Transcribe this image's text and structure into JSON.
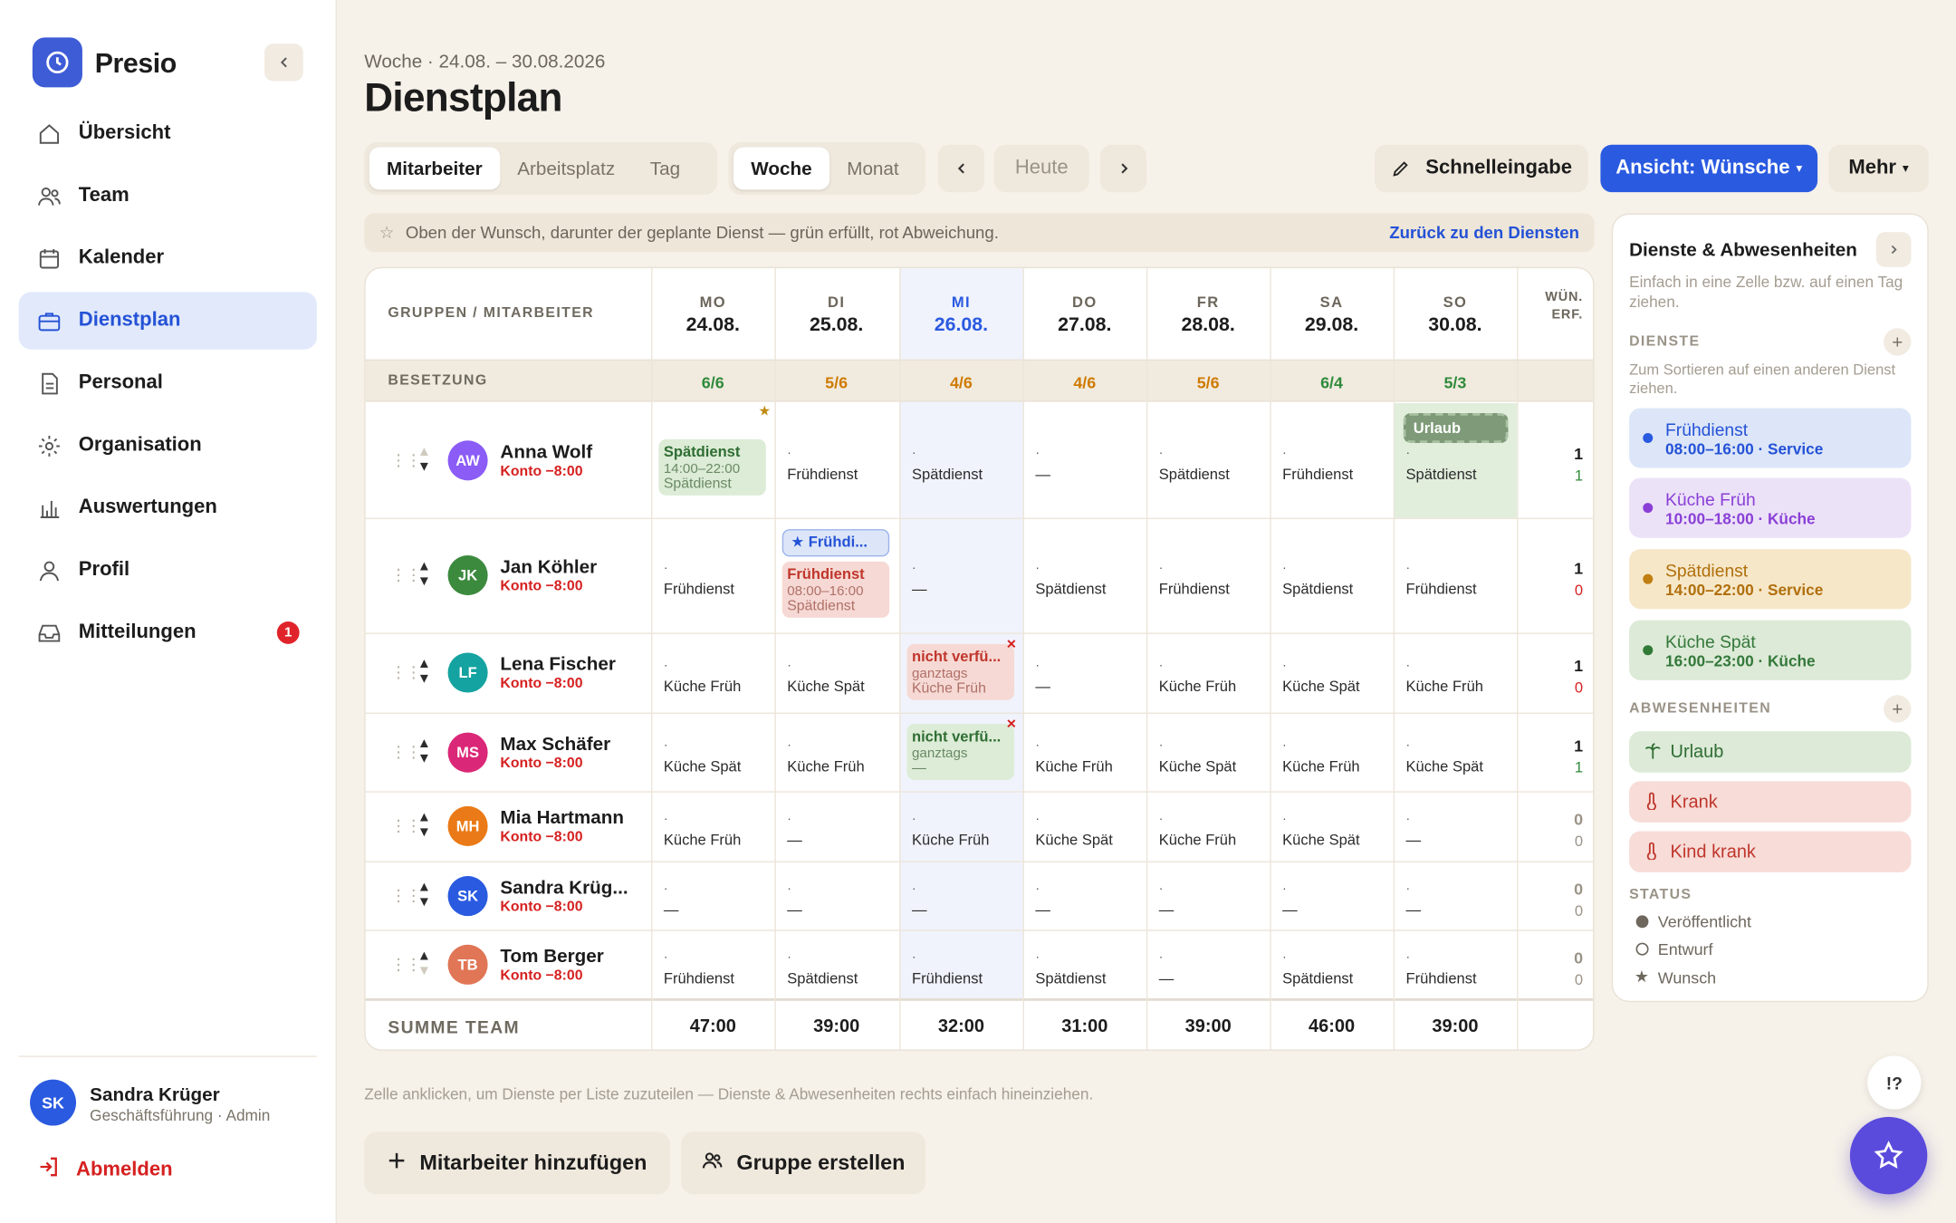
{
  "app": {
    "name": "Presio"
  },
  "nav": [
    {
      "label": "Übersicht",
      "icon": "home-icon",
      "active": false
    },
    {
      "label": "Team",
      "icon": "users-icon",
      "active": false
    },
    {
      "label": "Kalender",
      "icon": "calendar-icon",
      "active": false
    },
    {
      "label": "Dienstplan",
      "icon": "briefcase-icon",
      "active": true
    },
    {
      "label": "Personal",
      "icon": "document-icon",
      "active": false
    },
    {
      "label": "Organisation",
      "icon": "gear-icon",
      "active": false
    },
    {
      "label": "Auswertungen",
      "icon": "bar-chart-icon",
      "active": false
    },
    {
      "label": "Profil",
      "icon": "user-icon",
      "active": false
    },
    {
      "label": "Mitteilungen",
      "icon": "inbox-icon",
      "active": false,
      "badge": "1"
    }
  ],
  "user": {
    "initials": "SK",
    "name": "Sandra Krüger",
    "role": "Geschäftsführung · Admin",
    "logout": "Abmelden"
  },
  "header": {
    "subtitle": "Woche · 24.08. – 30.08.2026",
    "title": "Dienstplan"
  },
  "toolbar": {
    "group_tabs": [
      "Mitarbeiter",
      "Arbeitsplatz",
      "Tag"
    ],
    "group_active": "Mitarbeiter",
    "period_tabs": [
      "Woche",
      "Monat"
    ],
    "period_active": "Woche",
    "today": "Heute",
    "quick_entry": "Schnelleingabe",
    "view": "Ansicht: Wünsche",
    "more": "Mehr"
  },
  "hint": {
    "text": "Oben der Wunsch, darunter der geplante Dienst — grün erfüllt, rot Abweichung.",
    "link": "Zurück zu den Diensten"
  },
  "grid": {
    "group_header": "GRUPPEN / MITARBEITER",
    "wish_header_1": "WÜN.",
    "wish_header_2": "ERF.",
    "days": [
      {
        "name": "MO",
        "date": "24.08."
      },
      {
        "name": "DI",
        "date": "25.08."
      },
      {
        "name": "MI",
        "date": "26.08.",
        "today": true
      },
      {
        "name": "DO",
        "date": "27.08."
      },
      {
        "name": "FR",
        "date": "28.08."
      },
      {
        "name": "SA",
        "date": "29.08."
      },
      {
        "name": "SO",
        "date": "30.08."
      }
    ],
    "staffing_label": "BESETZUNG",
    "staffing": [
      "6/6",
      "5/6",
      "4/6",
      "4/6",
      "5/6",
      "6/4",
      "5/3"
    ],
    "sum_label": "SUMME TEAM",
    "sums": [
      "47:00",
      "39:00",
      "32:00",
      "31:00",
      "39:00",
      "46:00",
      "39:00"
    ]
  },
  "employees": [
    {
      "initials": "AW",
      "name": "Anna Wolf",
      "konto": "Konto −8:00",
      "color": "#8b5cf6",
      "cells": [
        {
          "type": "pill",
          "variant": "green",
          "title": "Spätdienst",
          "time": "14:00–22:00",
          "sub": "Spätdienst",
          "mark": "★"
        },
        {
          "dot": "·",
          "label": "Frühdienst"
        },
        {
          "dot": "·",
          "label": "Spätdienst"
        },
        {
          "dot": "·",
          "label": "—"
        },
        {
          "dot": "·",
          "label": "Spätdienst"
        },
        {
          "dot": "·",
          "label": "Frühdienst"
        },
        {
          "type": "leave",
          "badge": "Urlaub",
          "dot": "·",
          "label": "Spätdienst"
        }
      ],
      "wish": "1",
      "fulfilled": "1",
      "fulfilled_ok": true
    },
    {
      "initials": "JK",
      "name": "Jan Köhler",
      "konto": "Konto −8:00",
      "color": "#3c8a3e",
      "cells": [
        {
          "dot": "·",
          "label": "Frühdienst"
        },
        {
          "type": "wishpill",
          "wish": "★ Frühdi...",
          "title": "Frühdienst",
          "time": "08:00–16:00",
          "sub": "Spätdienst"
        },
        {
          "dot": "·",
          "label": "—"
        },
        {
          "dot": "·",
          "label": "Spätdienst"
        },
        {
          "dot": "·",
          "label": "Frühdienst"
        },
        {
          "dot": "·",
          "label": "Spätdienst"
        },
        {
          "dot": "·",
          "label": "Frühdienst"
        }
      ],
      "wish": "1",
      "fulfilled": "0",
      "fulfilled_ok": false
    },
    {
      "initials": "LF",
      "name": "Lena Fischer",
      "konto": "Konto −8:00",
      "color": "#14a3a0",
      "cells": [
        {
          "dot": "·",
          "label": "Küche Früh"
        },
        {
          "dot": "·",
          "label": "Küche Spät"
        },
        {
          "type": "pill",
          "variant": "red",
          "title": "nicht verfü...",
          "time": "ganztags",
          "sub": "Küche Früh",
          "mark": "×"
        },
        {
          "dot": "·",
          "label": "—"
        },
        {
          "dot": "·",
          "label": "Küche Früh"
        },
        {
          "dot": "·",
          "label": "Küche Spät"
        },
        {
          "dot": "·",
          "label": "Küche Früh"
        }
      ],
      "wish": "1",
      "fulfilled": "0",
      "fulfilled_ok": false
    },
    {
      "initials": "MS",
      "name": "Max Schäfer",
      "konto": "Konto −8:00",
      "color": "#db2777",
      "cells": [
        {
          "dot": "·",
          "label": "Küche Spät"
        },
        {
          "dot": "·",
          "label": "Küche Früh"
        },
        {
          "type": "pill",
          "variant": "green",
          "title": "nicht verfü...",
          "time": "ganztags",
          "sub": "—",
          "mark": "×"
        },
        {
          "dot": "·",
          "label": "Küche Früh"
        },
        {
          "dot": "·",
          "label": "Küche Spät"
        },
        {
          "dot": "·",
          "label": "Küche Früh"
        },
        {
          "dot": "·",
          "label": "Küche Spät"
        }
      ],
      "wish": "1",
      "fulfilled": "1",
      "fulfilled_ok": true
    },
    {
      "initials": "MH",
      "name": "Mia Hartmann",
      "konto": "Konto −8:00",
      "color": "#ea7a17",
      "cells": [
        {
          "dot": "·",
          "label": "Küche Früh"
        },
        {
          "dot": "·",
          "label": "—"
        },
        {
          "dot": "·",
          "label": "Küche Früh"
        },
        {
          "dot": "·",
          "label": "Küche Spät"
        },
        {
          "dot": "·",
          "label": "Küche Früh"
        },
        {
          "dot": "·",
          "label": "Küche Spät"
        },
        {
          "dot": "·",
          "label": "—"
        }
      ],
      "wish": "0",
      "fulfilled": "0",
      "fulfilled_ok": null
    },
    {
      "initials": "SK",
      "name": "Sandra Krüg...",
      "konto": "Konto −8:00",
      "color": "#2a5ae0",
      "cells": [
        {
          "dot": "·",
          "label": "—"
        },
        {
          "dot": "·",
          "label": "—"
        },
        {
          "dot": "·",
          "label": "—"
        },
        {
          "dot": "·",
          "label": "—"
        },
        {
          "dot": "·",
          "label": "—"
        },
        {
          "dot": "·",
          "label": "—"
        },
        {
          "dot": "·",
          "label": "—"
        }
      ],
      "wish": "0",
      "fulfilled": "0",
      "fulfilled_ok": null
    },
    {
      "initials": "TB",
      "name": "Tom Berger",
      "konto": "Konto −8:00",
      "color": "#e07656",
      "cells": [
        {
          "dot": "·",
          "label": "Frühdienst"
        },
        {
          "dot": "·",
          "label": "Spätdienst"
        },
        {
          "dot": "·",
          "label": "Frühdienst"
        },
        {
          "dot": "·",
          "label": "Spätdienst"
        },
        {
          "dot": "·",
          "label": "—"
        },
        {
          "dot": "·",
          "label": "Spätdienst"
        },
        {
          "dot": "·",
          "label": "Frühdienst"
        }
      ],
      "wish": "0",
      "fulfilled": "0",
      "fulfilled_ok": null,
      "down_disabled": true
    }
  ],
  "footer": {
    "hint": "Zelle anklicken, um Dienste per Liste zuzuteilen — Dienste & Abwesenheiten rechts einfach hineinziehen.",
    "add_employee": "Mitarbeiter hinzufügen",
    "create_group": "Gruppe erstellen"
  },
  "panel": {
    "title": "Dienste & Abwesenheiten",
    "desc": "Einfach in eine Zelle bzw. auf einen Tag ziehen.",
    "shifts_label": "DIENSTE",
    "shifts_sub": "Zum Sortieren auf einen anderen Dienst ziehen.",
    "shifts": [
      {
        "name": "Frühdienst",
        "time": "08:00–16:00 · Service",
        "bg": "#dde6f8",
        "fg": "#2452d6",
        "dot": "#2a5ae0"
      },
      {
        "name": "Küche Früh",
        "time": "10:00–18:00 · Küche",
        "bg": "#ece2f8",
        "fg": "#8a3fd6",
        "dot": "#8b3fd6"
      },
      {
        "name": "Spätdienst",
        "time": "14:00–22:00 · Service",
        "bg": "#f6e7c8",
        "fg": "#b06f0c",
        "dot": "#c07f12"
      },
      {
        "name": "Küche Spät",
        "time": "16:00–23:00 · Küche",
        "bg": "#dcead7",
        "fg": "#34783a",
        "dot": "#2f7a35"
      }
    ],
    "absences_label": "ABWESENHEITEN",
    "absences": [
      {
        "name": "Urlaub",
        "icon": "palm-icon",
        "bg": "#dcead7",
        "fg": "#2f6d33"
      },
      {
        "name": "Krank",
        "icon": "thermometer-icon",
        "bg": "#f7dcd7",
        "fg": "#c0362c"
      },
      {
        "name": "Kind krank",
        "icon": "thermometer-icon",
        "bg": "#f7dcd7",
        "fg": "#c0362c"
      }
    ],
    "status_label": "STATUS",
    "statuses": [
      "Veröffentlicht",
      "Entwurf",
      "Wunsch"
    ]
  },
  "fabs": {
    "help": "!?"
  }
}
